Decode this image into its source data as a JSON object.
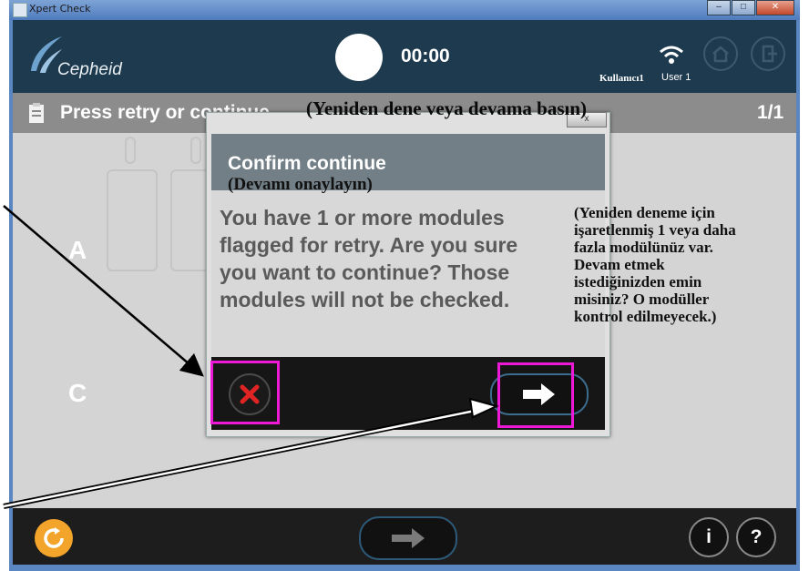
{
  "window": {
    "title": "Xpert Check"
  },
  "header": {
    "logo_text": "Cepheid",
    "timer": "00:00",
    "user_label": "Kullanıcı1",
    "user_name": "User 1"
  },
  "screen": {
    "title": "Press retry or continue",
    "title_translation": "(Yeniden dene veya devama basın)",
    "page": "1/1",
    "row_labels": [
      "A",
      "C"
    ]
  },
  "dialog": {
    "close_label": "x",
    "title": "Confirm continue",
    "title_translation": "(Devamı onaylayın)",
    "message_lines": [
      "You have 1 or more modules",
      "flagged for retry.  Are you sure",
      "you want to continue?  Those",
      "modules will not be checked."
    ],
    "message_translation_lines": [
      "(Yeniden deneme için",
      "işaretlenmiş 1 veya daha",
      "fazla modülünüz var.",
      "Devam etmek",
      "istediğinizden emin",
      "misiniz? O modüller",
      "kontrol edilmeyecek.)"
    ]
  },
  "bottom_bar": {
    "info_label": "i",
    "help_label": "?"
  },
  "colors": {
    "header_bg": "#1e3a4f",
    "title_bar_bg": "#8c8c8c",
    "content_bg": "#d4d4d4",
    "footer_bg": "#1d1d1d",
    "highlight": "#ee19d6",
    "cancel_red": "#e02424",
    "refresh_orange": "#f3a52b"
  },
  "icons": [
    "cepheid-logo",
    "timer-circle",
    "wifi-icon",
    "home-icon",
    "exit-icon",
    "clipboard-icon",
    "cancel-x-icon",
    "arrow-right-icon",
    "refresh-icon",
    "info-icon",
    "help-icon"
  ]
}
